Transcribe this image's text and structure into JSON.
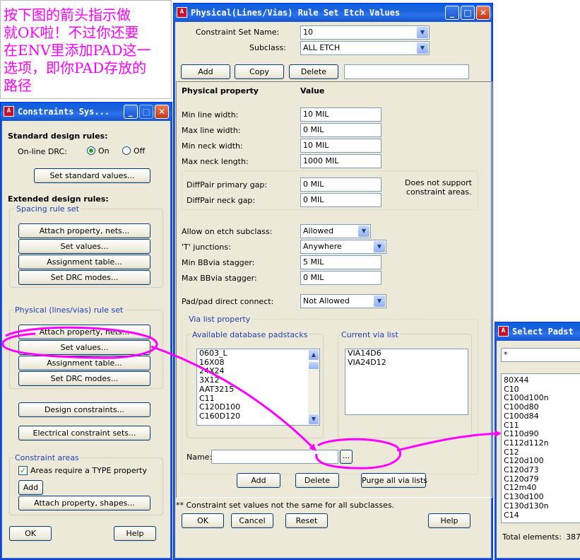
{
  "annotation": {
    "lines": [
      "按下图的箭头指示做",
      "就OK啦！不过你还要",
      "在ENV里添加PAD这一",
      "选项，即你PAD存放的",
      "路径"
    ],
    "color": "#ff00ff",
    "arrow_color": "#ff00ff"
  },
  "constraints_window": {
    "title": "Constraints Sys...",
    "standard_heading": "Standard design rules:",
    "online_drc_label": "On-line DRC:",
    "on_label": "On",
    "off_label": "Off",
    "online_drc_selected": "On",
    "set_standard_values": "Set standard values...",
    "extended_heading": "Extended design rules:",
    "spacing_group_title": "Spacing rule set",
    "spacing_buttons": [
      "Attach property, nets...",
      "Set values...",
      "Assignment table...",
      "Set DRC modes..."
    ],
    "physical_group_title": "Physical (lines/vias) rule set",
    "physical_buttons": [
      "Attach property, nets...",
      "Set values...",
      "Assignment table...",
      "Set DRC modes..."
    ],
    "design_constraints": "Design constraints...",
    "electrical_sets": "Electrical constraint sets...",
    "areas_group_title": "Constraint areas",
    "areas_checkbox_label": "Areas require a TYPE property",
    "areas_checked": true,
    "add_label": "Add",
    "attach_shapes": "Attach property, shapes...",
    "ok_label": "OK",
    "help_label": "Help"
  },
  "physical_window": {
    "title": "Physical(Lines/Vias) Rule Set Etch Values",
    "constraint_set_label": "Constraint Set Name:",
    "constraint_set_value": "10",
    "subclass_label": "Subclass:",
    "subclass_value": "ALL ETCH",
    "add_label": "Add",
    "copy_label": "Copy",
    "delete_label": "Delete",
    "name_entry_value": "",
    "col_property": "Physical property",
    "col_value": "Value",
    "rows": [
      {
        "label": "Min line width:",
        "value": "10 MIL"
      },
      {
        "label": "Max line width:",
        "value": "0 MIL"
      },
      {
        "label": "Min neck width:",
        "value": "10 MIL"
      },
      {
        "label": "Max neck length:",
        "value": "1000 MIL"
      }
    ],
    "diffpair_rows": [
      {
        "label": "DiffPair primary gap:",
        "value": "0 MIL"
      },
      {
        "label": "DiffPair neck gap:",
        "value": "0 MIL"
      }
    ],
    "diffpair_note": [
      "Does not support",
      "constraint areas."
    ],
    "allow_etch_label": "Allow on etch subclass:",
    "allow_etch_value": "Allowed",
    "t_junctions_label": "'T' junctions:",
    "t_junctions_value": "Anywhere",
    "min_bbvia_label": "Min BBvia stagger:",
    "min_bbvia_value": "5 MIL",
    "max_bbvia_label": "Max BBvia stagger:",
    "max_bbvia_value": "0 MIL",
    "padpad_label": "Pad/pad direct connect:",
    "padpad_value": "Not Allowed",
    "via_list_title": "Via list property",
    "available_title": "Available database padstacks",
    "available_items": [
      "0603_L",
      "16X08",
      "24X24",
      "3X12",
      "AAT3215",
      "C11",
      "C120D100",
      "C160D120"
    ],
    "current_title": "Current via list",
    "current_items": [
      "VIA14D6",
      "VIA24D12"
    ],
    "name_label": "Name:",
    "name_value": "",
    "browse_label": "...",
    "via_add": "Add",
    "via_delete": "Delete",
    "purge_label": "Purge all via lists",
    "footnote": "** Constraint set values not the same for all subclasses.",
    "ok_label": "OK",
    "cancel_label": "Cancel",
    "reset_label": "Reset",
    "help_label": "Help"
  },
  "padstack_window": {
    "title": "Select Padst",
    "filter_value": "*",
    "items": [
      "80X44",
      "C10",
      "C100d100n",
      "C100d80",
      "C100d84",
      "C11",
      "C110d90",
      "C112d112n",
      "C12",
      "C120d100",
      "C120d73",
      "C120d79",
      "C12m40",
      "C130d100",
      "C130d130n",
      "C14"
    ],
    "total_label": "Total elements:",
    "total_value": "387"
  }
}
